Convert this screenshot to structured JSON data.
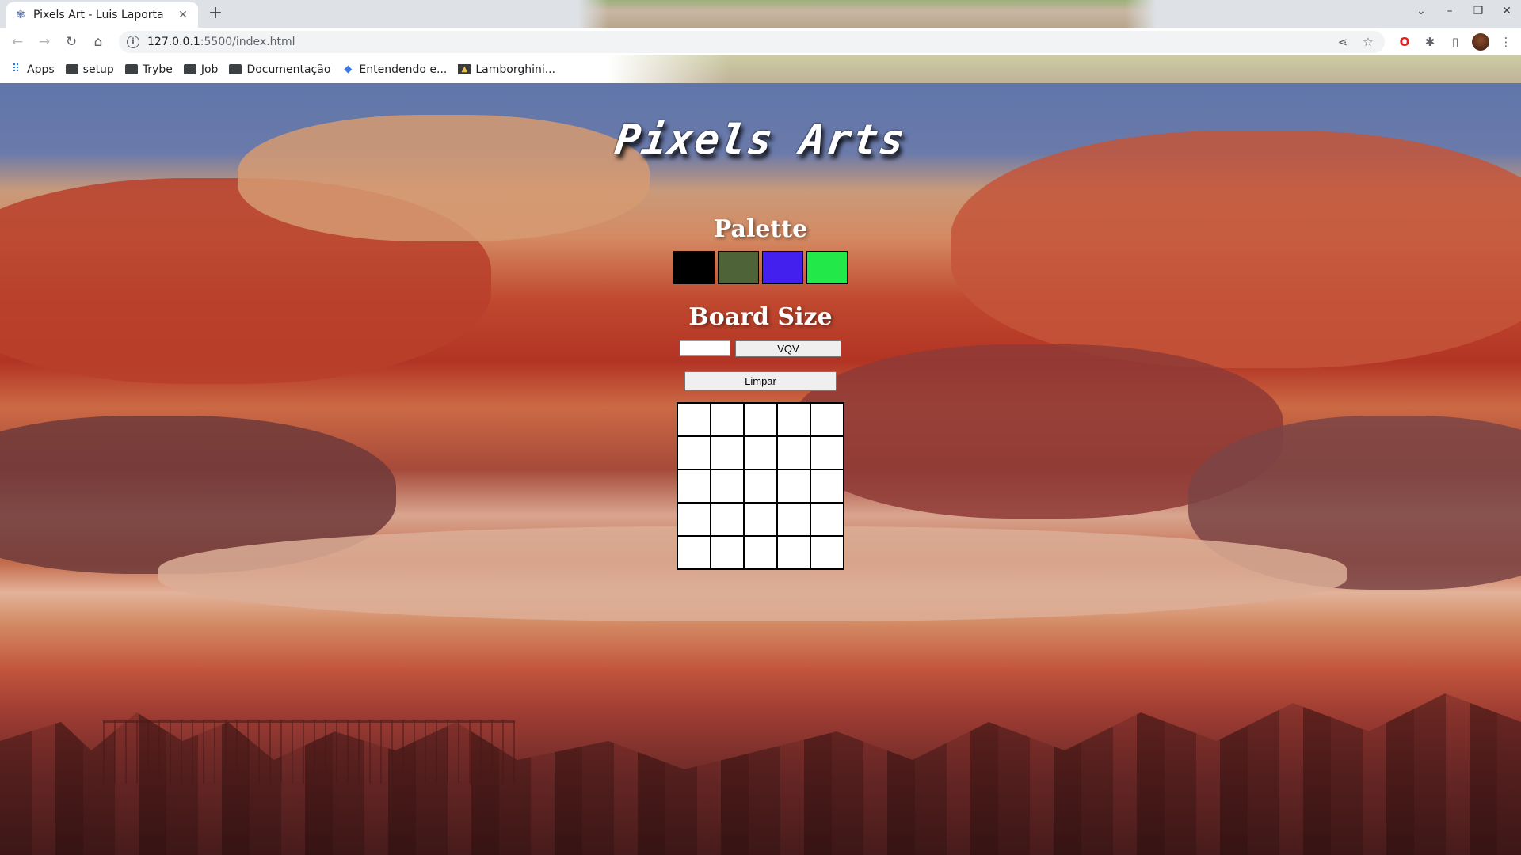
{
  "browser": {
    "tab_title": "Pixels Art - Luis Laporta",
    "url_host": "127.0.0.1",
    "url_path": ":5500/index.html",
    "bookmarks": [
      {
        "label": "Apps",
        "icon": "apps-grid-icon"
      },
      {
        "label": "setup",
        "icon": "folder-icon"
      },
      {
        "label": "Trybe",
        "icon": "folder-icon"
      },
      {
        "label": "Job",
        "icon": "folder-icon"
      },
      {
        "label": "Documentação",
        "icon": "folder-icon"
      },
      {
        "label": "Entendendo e...",
        "icon": "cube-icon"
      },
      {
        "label": "Lamborghini...",
        "icon": "car-icon"
      }
    ]
  },
  "page": {
    "title": "Pixels Arts",
    "palette_heading": "Palette",
    "palette_colors": [
      "#000000",
      "#4f6338",
      "#4420ee",
      "#22e84a"
    ],
    "board_heading": "Board Size",
    "board_input_value": "",
    "vqv_label": "VQV",
    "clear_label": "Limpar",
    "board_size": 5
  }
}
